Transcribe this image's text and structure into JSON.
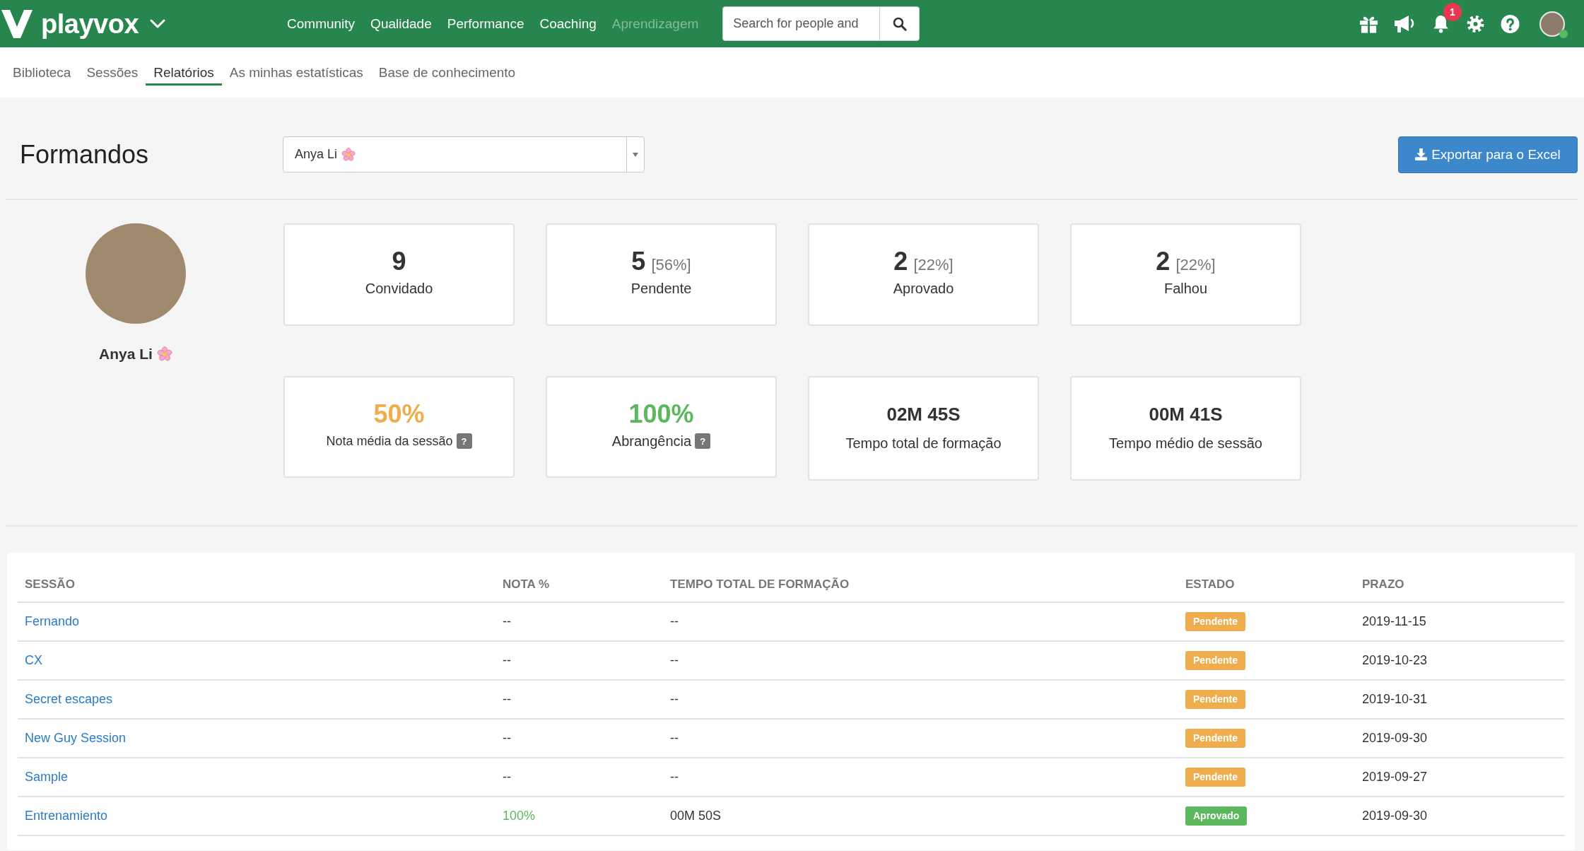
{
  "top_nav": {
    "logo": "playvox",
    "links": [
      {
        "label": "Community",
        "selected": false
      },
      {
        "label": "Qualidade",
        "selected": false
      },
      {
        "label": "Performance",
        "selected": false
      },
      {
        "label": "Coaching",
        "selected": false
      },
      {
        "label": "Aprendizagem",
        "selected": true
      }
    ],
    "search": {
      "placeholder": "Search for people and"
    },
    "notifications": "1",
    "user": {
      "online": true
    }
  },
  "sub_nav": {
    "tabs": [
      {
        "label": "Biblioteca",
        "selected": false
      },
      {
        "label": "Sessões",
        "selected": false
      },
      {
        "label": "Relatórios",
        "selected": true
      },
      {
        "label": "As minhas estatísticas",
        "selected": false
      },
      {
        "label": "Base de conhecimento",
        "selected": false
      }
    ]
  },
  "header": {
    "title": "Formandos",
    "trainee_select": {
      "value": "Anya Li"
    },
    "export_button": "Exportar para o Excel"
  },
  "profile": {
    "name": "Anya Li"
  },
  "summary": [
    {
      "value": "9",
      "label": "Convidado"
    },
    {
      "value": "5",
      "percent": "[56%]",
      "label": "Pendente"
    },
    {
      "value": "2",
      "percent": "[22%]",
      "label": "Aprovado"
    },
    {
      "value": "2",
      "percent": "[22%]",
      "label": "Falhou"
    }
  ],
  "metrics": [
    {
      "kind": "percentage",
      "value": "50%",
      "color": "#f0ad4e",
      "label": "Nota média da sessão",
      "help": "?"
    },
    {
      "kind": "percentage",
      "value": "100%",
      "color": "#5cb85c",
      "label": "Abrangência",
      "help": "?"
    },
    {
      "kind": "duration",
      "value": "02M 45S",
      "label": "Tempo total de formação"
    },
    {
      "kind": "duration",
      "value": "00M 41S",
      "label": "Tempo médio de sessão"
    }
  ],
  "table": {
    "columns": [
      "SESSÃO",
      "NOTA %",
      "TEMPO TOTAL DE FORMAÇÃO",
      "ESTADO",
      "PRAZO"
    ],
    "rows": [
      {
        "session": "Fernando",
        "score": {
          "text": "--",
          "color": "#333333"
        },
        "time": "--",
        "status": {
          "label": "Pendente",
          "color": "#f0ad4e"
        },
        "deadline": "2019-11-15"
      },
      {
        "session": "CX",
        "score": {
          "text": "--",
          "color": "#333333"
        },
        "time": "--",
        "status": {
          "label": "Pendente",
          "color": "#f0ad4e"
        },
        "deadline": "2019-10-23"
      },
      {
        "session": "Secret escapes",
        "score": {
          "text": "--",
          "color": "#333333"
        },
        "time": "--",
        "status": {
          "label": "Pendente",
          "color": "#f0ad4e"
        },
        "deadline": "2019-10-31"
      },
      {
        "session": "New Guy Session",
        "score": {
          "text": "--",
          "color": "#333333"
        },
        "time": "--",
        "status": {
          "label": "Pendente",
          "color": "#f0ad4e"
        },
        "deadline": "2019-09-30"
      },
      {
        "session": "Sample",
        "score": {
          "text": "--",
          "color": "#333333"
        },
        "time": "--",
        "status": {
          "label": "Pendente",
          "color": "#f0ad4e"
        },
        "deadline": "2019-09-27"
      },
      {
        "session": "Entrenamiento",
        "score": {
          "text": "100%",
          "color": "#5cb85c"
        },
        "time": "00M 50S",
        "status": {
          "label": "Aprovado",
          "color": "#5cb85c"
        },
        "deadline": "2019-09-30"
      }
    ]
  }
}
